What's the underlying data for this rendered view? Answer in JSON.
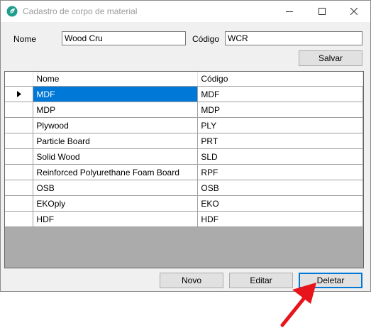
{
  "window": {
    "title": "Cadastro de corpo de material"
  },
  "form": {
    "nome_label": "Nome",
    "nome_value": "Wood Cru",
    "codigo_label": "Código",
    "codigo_value": "WCR",
    "salvar_label": "Salvar"
  },
  "grid": {
    "columns": [
      "Nome",
      "Código"
    ],
    "selected_row": 0,
    "rows": [
      {
        "nome": "MDF",
        "codigo": "MDF"
      },
      {
        "nome": "MDP",
        "codigo": "MDP"
      },
      {
        "nome": "Plywood",
        "codigo": "PLY"
      },
      {
        "nome": "Particle Board",
        "codigo": "PRT"
      },
      {
        "nome": "Solid Wood",
        "codigo": "SLD"
      },
      {
        "nome": "Reinforced Polyurethane Foam Board",
        "codigo": "RPF"
      },
      {
        "nome": "OSB",
        "codigo": "OSB"
      },
      {
        "nome": "EKOply",
        "codigo": "EKO"
      },
      {
        "nome": "HDF",
        "codigo": "HDF"
      }
    ]
  },
  "actions": {
    "novo_label": "Novo",
    "editar_label": "Editar",
    "deletar_label": "Deletar"
  },
  "colors": {
    "selection": "#0078d7",
    "annotation_arrow": "#e8141c"
  },
  "icons": [
    "app-icon",
    "minimize-icon",
    "maximize-icon",
    "close-icon",
    "row-pointer-icon",
    "annotation-arrow"
  ]
}
